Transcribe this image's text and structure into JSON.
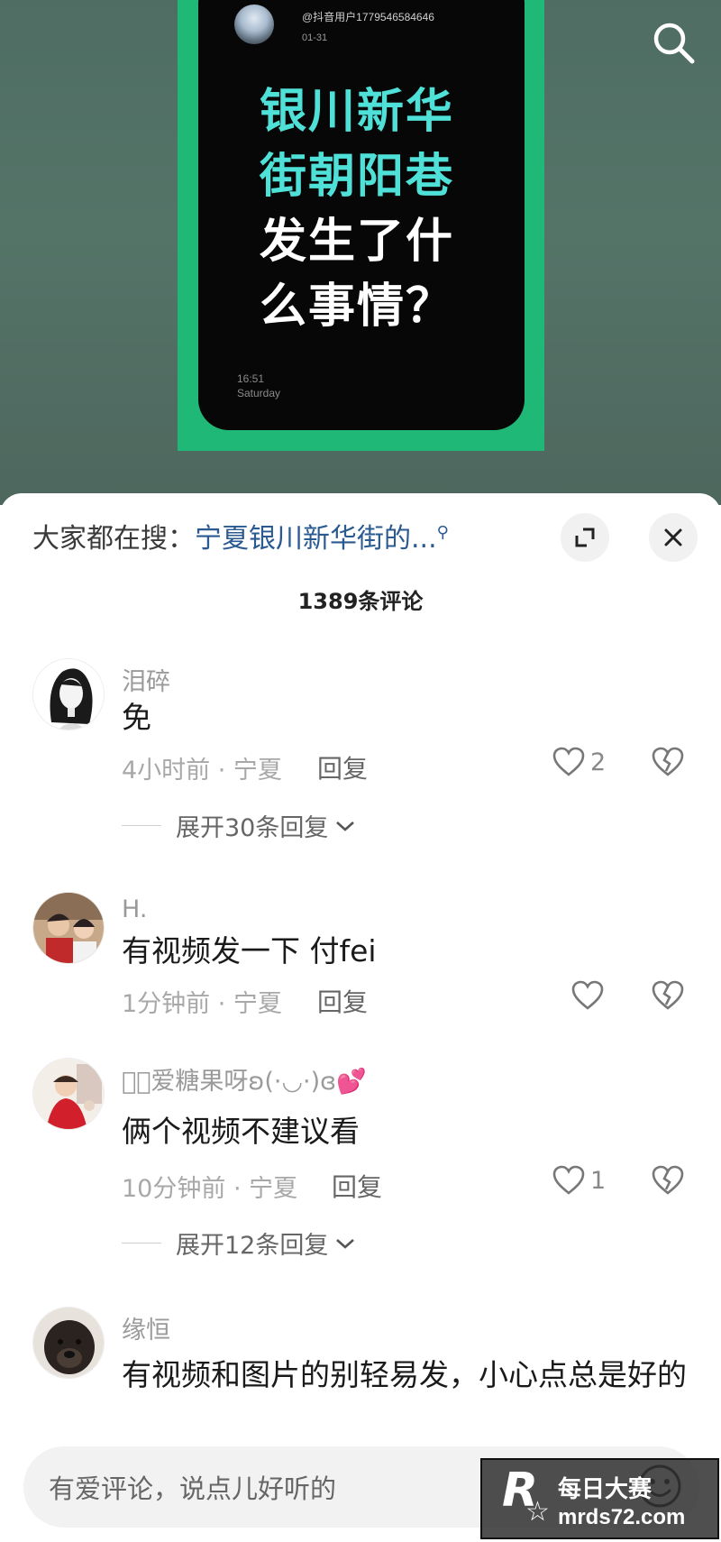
{
  "video": {
    "card_user": "@抖音用户1779546584646",
    "card_date": "01-31",
    "headline_teal": [
      "银川新华",
      "街朝阳巷"
    ],
    "headline_white": [
      "发生了什",
      "么事情？"
    ],
    "card_clock": "16:51",
    "card_day": "Saturday"
  },
  "sheet": {
    "hot_search_label": "大家都在搜：",
    "hot_search_term": "宁夏银川新华街的...",
    "comment_count": "1389条评论"
  },
  "comments": [
    {
      "name": "泪碎",
      "text": "免",
      "meta": "4小时前 · 宁夏",
      "reply": "回复",
      "likes": "2",
      "expand": "展开30条回复"
    },
    {
      "name": "H.",
      "text": "有视频发一下  付fei",
      "meta": "1分钟前 · 宁夏",
      "reply": "回复",
      "likes": "",
      "expand": ""
    },
    {
      "name": "𝓜ꦿ爱糖果呀ʚ(·◡·)ɞ💕",
      "text": "俩个视频不建议看",
      "meta": "10分钟前 · 宁夏",
      "reply": "回复",
      "likes": "1",
      "expand": "展开12条回复"
    },
    {
      "name": "缘恒",
      "text": "有视频和图片的别轻易发，小心点总是好的",
      "meta": "",
      "reply": "",
      "likes": "",
      "expand": ""
    }
  ],
  "input": {
    "placeholder": "有爱评论，说点儿好听的"
  },
  "watermark": {
    "logo_letter": "R",
    "cn": "每日大赛",
    "url": "mrds72.com"
  },
  "colors": {
    "teal_headline": "#4fe0d8",
    "green_frame": "#1fb877",
    "hot_search_term": "#2a5a90"
  }
}
